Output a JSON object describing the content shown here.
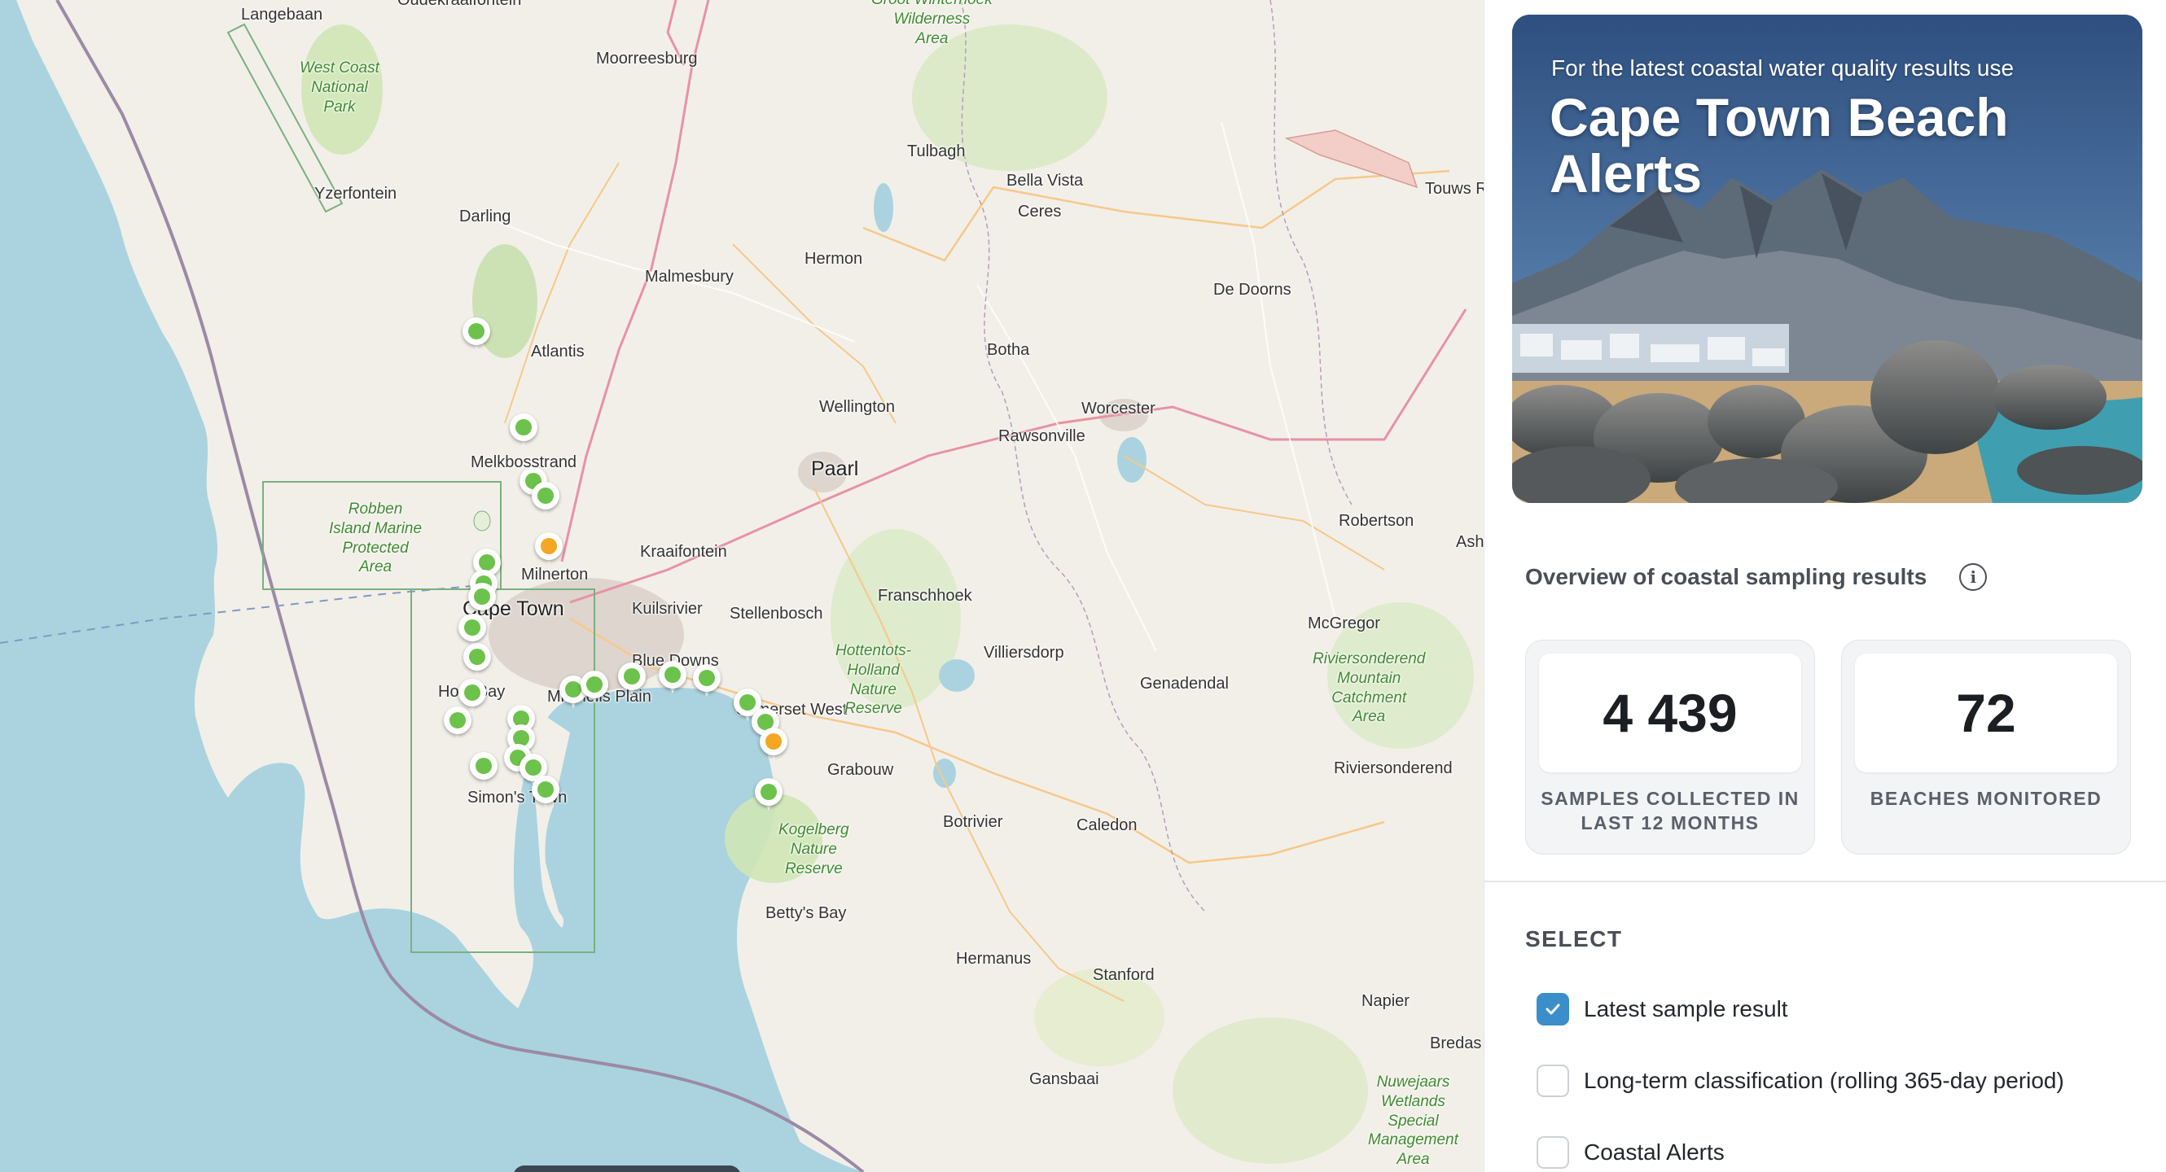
{
  "map": {
    "places": [
      {
        "name": "Langebaan",
        "cls": ""
      },
      {
        "name": "Oudekraalfontein",
        "cls": ""
      },
      {
        "name": "Moorreesburg",
        "cls": ""
      },
      {
        "name": "Yzerfontein",
        "cls": ""
      },
      {
        "name": "Darling",
        "cls": ""
      },
      {
        "name": "Tulbagh",
        "cls": ""
      },
      {
        "name": "Bella Vista",
        "cls": ""
      },
      {
        "name": "Ceres",
        "cls": ""
      },
      {
        "name": "Touws R",
        "cls": ""
      },
      {
        "name": "Hermon",
        "cls": ""
      },
      {
        "name": "Malmesbury",
        "cls": ""
      },
      {
        "name": "De Doorns",
        "cls": ""
      },
      {
        "name": "Atlantis",
        "cls": ""
      },
      {
        "name": "Botha",
        "cls": ""
      },
      {
        "name": "Wellington",
        "cls": ""
      },
      {
        "name": "Worcester",
        "cls": ""
      },
      {
        "name": "Rawsonville",
        "cls": ""
      },
      {
        "name": "Melkbosstrand",
        "cls": ""
      },
      {
        "name": "Paarl",
        "cls": "big"
      },
      {
        "name": "Robertson",
        "cls": ""
      },
      {
        "name": "Ash",
        "cls": ""
      },
      {
        "name": "Kraaifontein",
        "cls": ""
      },
      {
        "name": "Milnerton",
        "cls": ""
      },
      {
        "name": "Franschhoek",
        "cls": ""
      },
      {
        "name": "Kuilsrivier",
        "cls": ""
      },
      {
        "name": "Stellenbosch",
        "cls": ""
      },
      {
        "name": "Cape Town",
        "cls": "big"
      },
      {
        "name": "McGregor",
        "cls": ""
      },
      {
        "name": "Villiersdorp",
        "cls": ""
      },
      {
        "name": "Blue Downs",
        "cls": ""
      },
      {
        "name": "Genadendal",
        "cls": ""
      },
      {
        "name": "Hout Bay",
        "cls": ""
      },
      {
        "name": "Mitchells Plain",
        "cls": ""
      },
      {
        "name": "Somerset West",
        "cls": ""
      },
      {
        "name": "Grabouw",
        "cls": ""
      },
      {
        "name": "Riviersonderend",
        "cls": ""
      },
      {
        "name": "Botrivier",
        "cls": ""
      },
      {
        "name": "Caledon",
        "cls": ""
      },
      {
        "name": "Simon's Town",
        "cls": ""
      },
      {
        "name": "Betty's Bay",
        "cls": ""
      },
      {
        "name": "Hermanus",
        "cls": ""
      },
      {
        "name": "Stanford",
        "cls": ""
      },
      {
        "name": "Napier",
        "cls": ""
      },
      {
        "name": "Bredas",
        "cls": ""
      },
      {
        "name": "Gansbaai",
        "cls": ""
      }
    ],
    "areas": [
      {
        "name": "West Coast\nNational\nPark"
      },
      {
        "name": "Groot Winterhoek\nWilderness\nArea"
      },
      {
        "name": "Robben\nIsland Marine\nProtected\nArea"
      },
      {
        "name": "Hottentots-\nHolland\nNature\nReserve"
      },
      {
        "name": "Kogelberg\nNature\nReserve"
      },
      {
        "name": "Riviersonderend\nMountain\nCatchment\nArea"
      },
      {
        "name": "Nuwejaars\nWetlands\nSpecial\nManagement\nArea"
      }
    ],
    "markers": [
      {
        "status": "good"
      },
      {
        "status": "good"
      },
      {
        "status": "good"
      },
      {
        "status": "good"
      },
      {
        "status": "moderate"
      },
      {
        "status": "good"
      },
      {
        "status": "good"
      },
      {
        "status": "good"
      },
      {
        "status": "good"
      },
      {
        "status": "good"
      },
      {
        "status": "good"
      },
      {
        "status": "good"
      },
      {
        "status": "good"
      },
      {
        "status": "good"
      },
      {
        "status": "good"
      },
      {
        "status": "good"
      },
      {
        "status": "good"
      },
      {
        "status": "good"
      },
      {
        "status": "good"
      },
      {
        "status": "good"
      },
      {
        "status": "good"
      },
      {
        "status": "moderate"
      },
      {
        "status": "good"
      },
      {
        "status": "good"
      },
      {
        "status": "good"
      },
      {
        "status": "good"
      },
      {
        "status": "good"
      }
    ],
    "status_colors": {
      "good": "#6cc24a",
      "moderate": "#f5a623"
    }
  },
  "hero": {
    "subtitle": "For the latest coastal water quality results use",
    "title": "Cape Town Beach Alerts"
  },
  "overview": {
    "label": "Overview of coastal sampling results",
    "info_icon": "info-icon"
  },
  "stats": [
    {
      "value": "4 439",
      "label": "SAMPLES COLLECTED IN LAST 12 MONTHS"
    },
    {
      "value": "72",
      "label": "BEACHES MONITORED"
    }
  ],
  "select": {
    "heading": "SELECT",
    "options": [
      {
        "label": "Latest sample result",
        "checked": true
      },
      {
        "label": "Long-term classification (rolling 365-day period)",
        "checked": false
      },
      {
        "label": "Coastal Alerts",
        "checked": false
      }
    ]
  },
  "colors": {
    "accent": "#3b8ec9",
    "sea": "#aad3df",
    "land": "#f2efe9"
  }
}
